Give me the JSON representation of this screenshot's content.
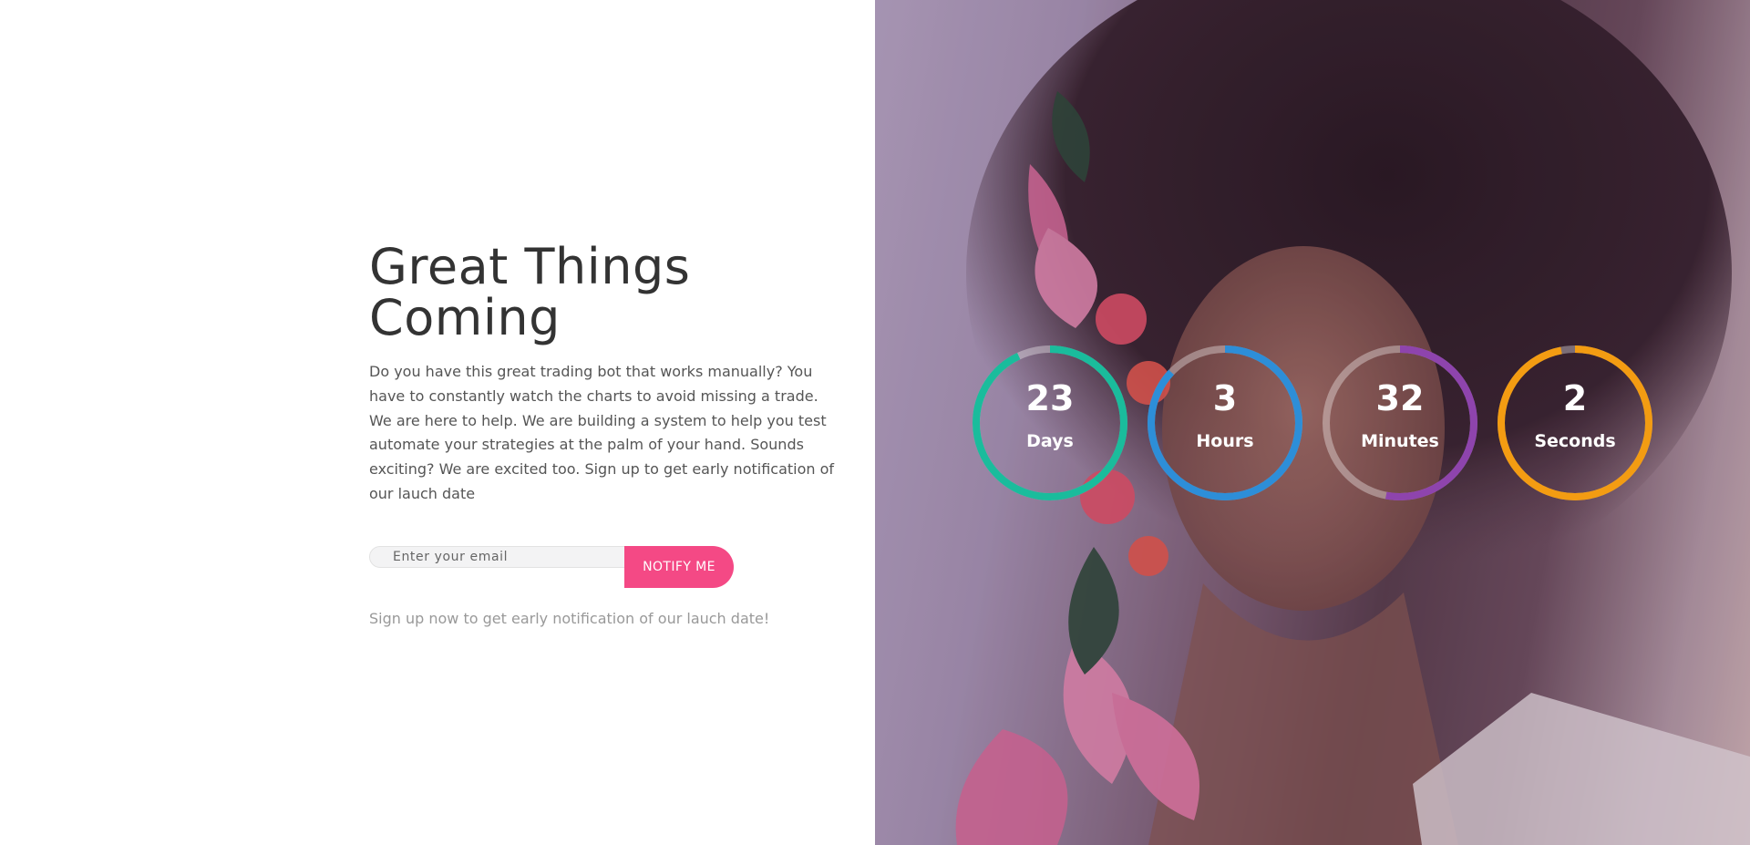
{
  "hero": {
    "headline": "Great Things Coming",
    "description": "Do you have this great trading bot that works manually? You have to constantly watch the charts to avoid missing a trade. We are here to help. We are building a system to help you test automate your strategies at the palm of your hand. Sounds exciting? We are excited too. Sign up to get early notification of our lauch date"
  },
  "signup": {
    "email_placeholder": "Enter your email",
    "button_label": "NOTIFY ME",
    "note": "Sign up now to get early notification of our lauch date!"
  },
  "countdown": [
    {
      "value": "23",
      "label": "Days",
      "color": "#1abc9c",
      "progress": 0.93
    },
    {
      "value": "3",
      "label": "Hours",
      "color": "#2d8ed8",
      "progress": 0.87
    },
    {
      "value": "32",
      "label": "Minutes",
      "color": "#8e44ad",
      "progress": 0.53
    },
    {
      "value": "2",
      "label": "Seconds",
      "color": "#f39c12",
      "progress": 0.97
    }
  ],
  "colors": {
    "accent": "#f44985",
    "heading": "#333333",
    "body_text": "#555555",
    "muted_text": "#999999"
  }
}
